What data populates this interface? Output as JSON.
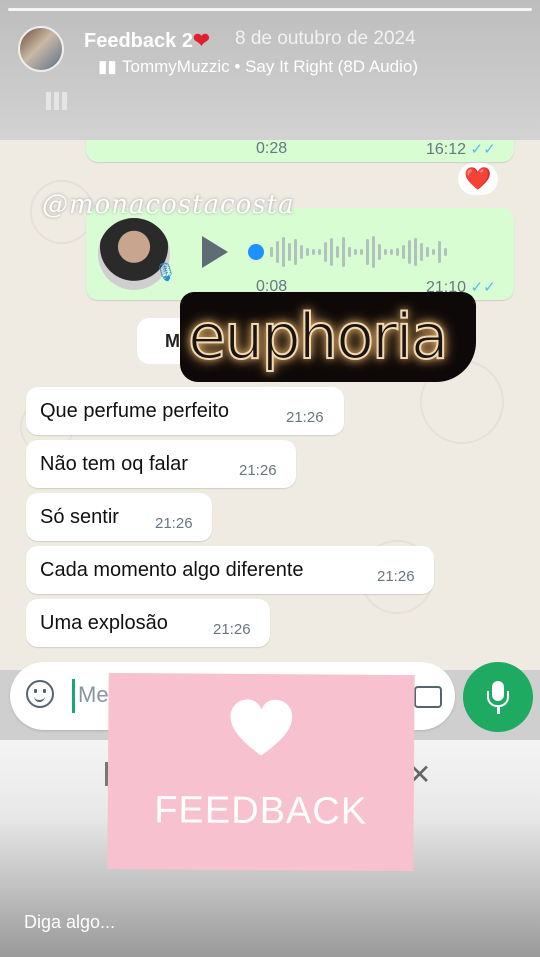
{
  "story": {
    "title": "Feedback 2",
    "date": "8 de outubro de 2024",
    "music": "TommyMuzzic • Say It Right (8D Audio)"
  },
  "chat": {
    "watermark": "@monacostacosta",
    "prev_audio": {
      "duration": "0:28",
      "time": "16:12"
    },
    "reaction": "❤️",
    "audio": {
      "duration": "0:08",
      "time": "21:10"
    },
    "day_chip_partial": "M",
    "sticker": "euphoria",
    "messages": [
      {
        "text": "Que perfume perfeito",
        "time": "21:26"
      },
      {
        "text": "Não tem oq falar",
        "time": "21:26"
      },
      {
        "text": "Só sentir",
        "time": "21:26"
      },
      {
        "text": "Cada momento algo diferente",
        "time": "21:26"
      },
      {
        "text": "Uma explosão",
        "time": "21:26"
      }
    ]
  },
  "input": {
    "placeholder_partial": "Me"
  },
  "overlay": {
    "label": "FEEDBACK"
  },
  "reply": {
    "placeholder": "Diga algo..."
  },
  "colors": {
    "bubble_out": "#d9fdd3",
    "mic": "#1eaa61",
    "feedback_card": "#f7c1cf",
    "ticks": "#53bdeb"
  }
}
